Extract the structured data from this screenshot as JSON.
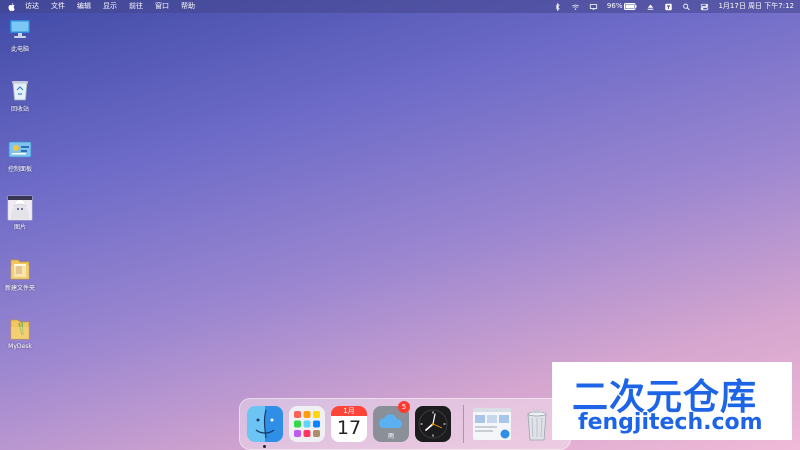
{
  "menubar": {
    "apple_icon": "apple-logo-icon",
    "items": [
      "访达",
      "文件",
      "编辑",
      "显示",
      "前往",
      "窗口",
      "帮助"
    ],
    "battery_percent": "96%",
    "datetime": "1月17日 周日 下午7:12"
  },
  "desktop": {
    "icons": [
      {
        "label": "此电脑",
        "icon": "computer-icon"
      },
      {
        "label": "回收站",
        "icon": "recycle-bin-icon"
      },
      {
        "label": "控制面板",
        "icon": "control-panel-icon"
      },
      {
        "label": "图片",
        "icon": "anime-picture-icon"
      },
      {
        "label": "新建文件夹",
        "icon": "folder-icon"
      },
      {
        "label": "MyDesk",
        "icon": "folder-icon"
      }
    ]
  },
  "dock": {
    "calendar_month": "1月",
    "calendar_day": "17",
    "weather_badge": "5",
    "weather_text": "雨"
  },
  "watermark": {
    "cn": "二次元仓库",
    "en": "fengjitech.com"
  },
  "colors": {
    "accent": "#1e64e6",
    "badge": "#ff3b30"
  }
}
